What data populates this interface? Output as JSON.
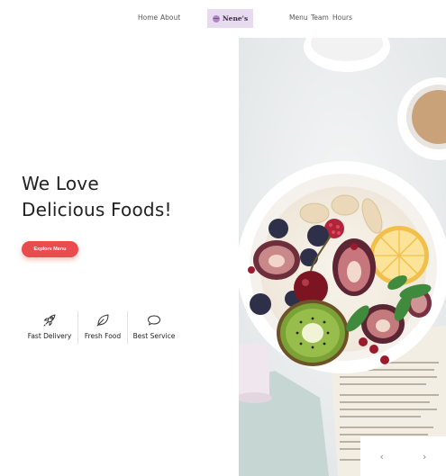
{
  "nav": {
    "left_links": [
      "Home",
      "About"
    ],
    "brand": "Nene's",
    "right_links": [
      "Menu",
      "Team",
      "Hours"
    ]
  },
  "hero": {
    "title_line1": "We Love",
    "title_line2": "Delicious Foods!",
    "cta_label": "Explore Menu"
  },
  "features": [
    {
      "label": "Fast Delivery",
      "icon": "rocket-icon"
    },
    {
      "label": "Fresh Food",
      "icon": "leaf-icon"
    },
    {
      "label": "Best Service",
      "icon": "chat-bubble-icon"
    }
  ],
  "slider": {
    "prev_icon": "‹",
    "next_icon": "›"
  },
  "colors": {
    "accent": "#e94c4c",
    "brand_bg": "#e7dcef"
  }
}
